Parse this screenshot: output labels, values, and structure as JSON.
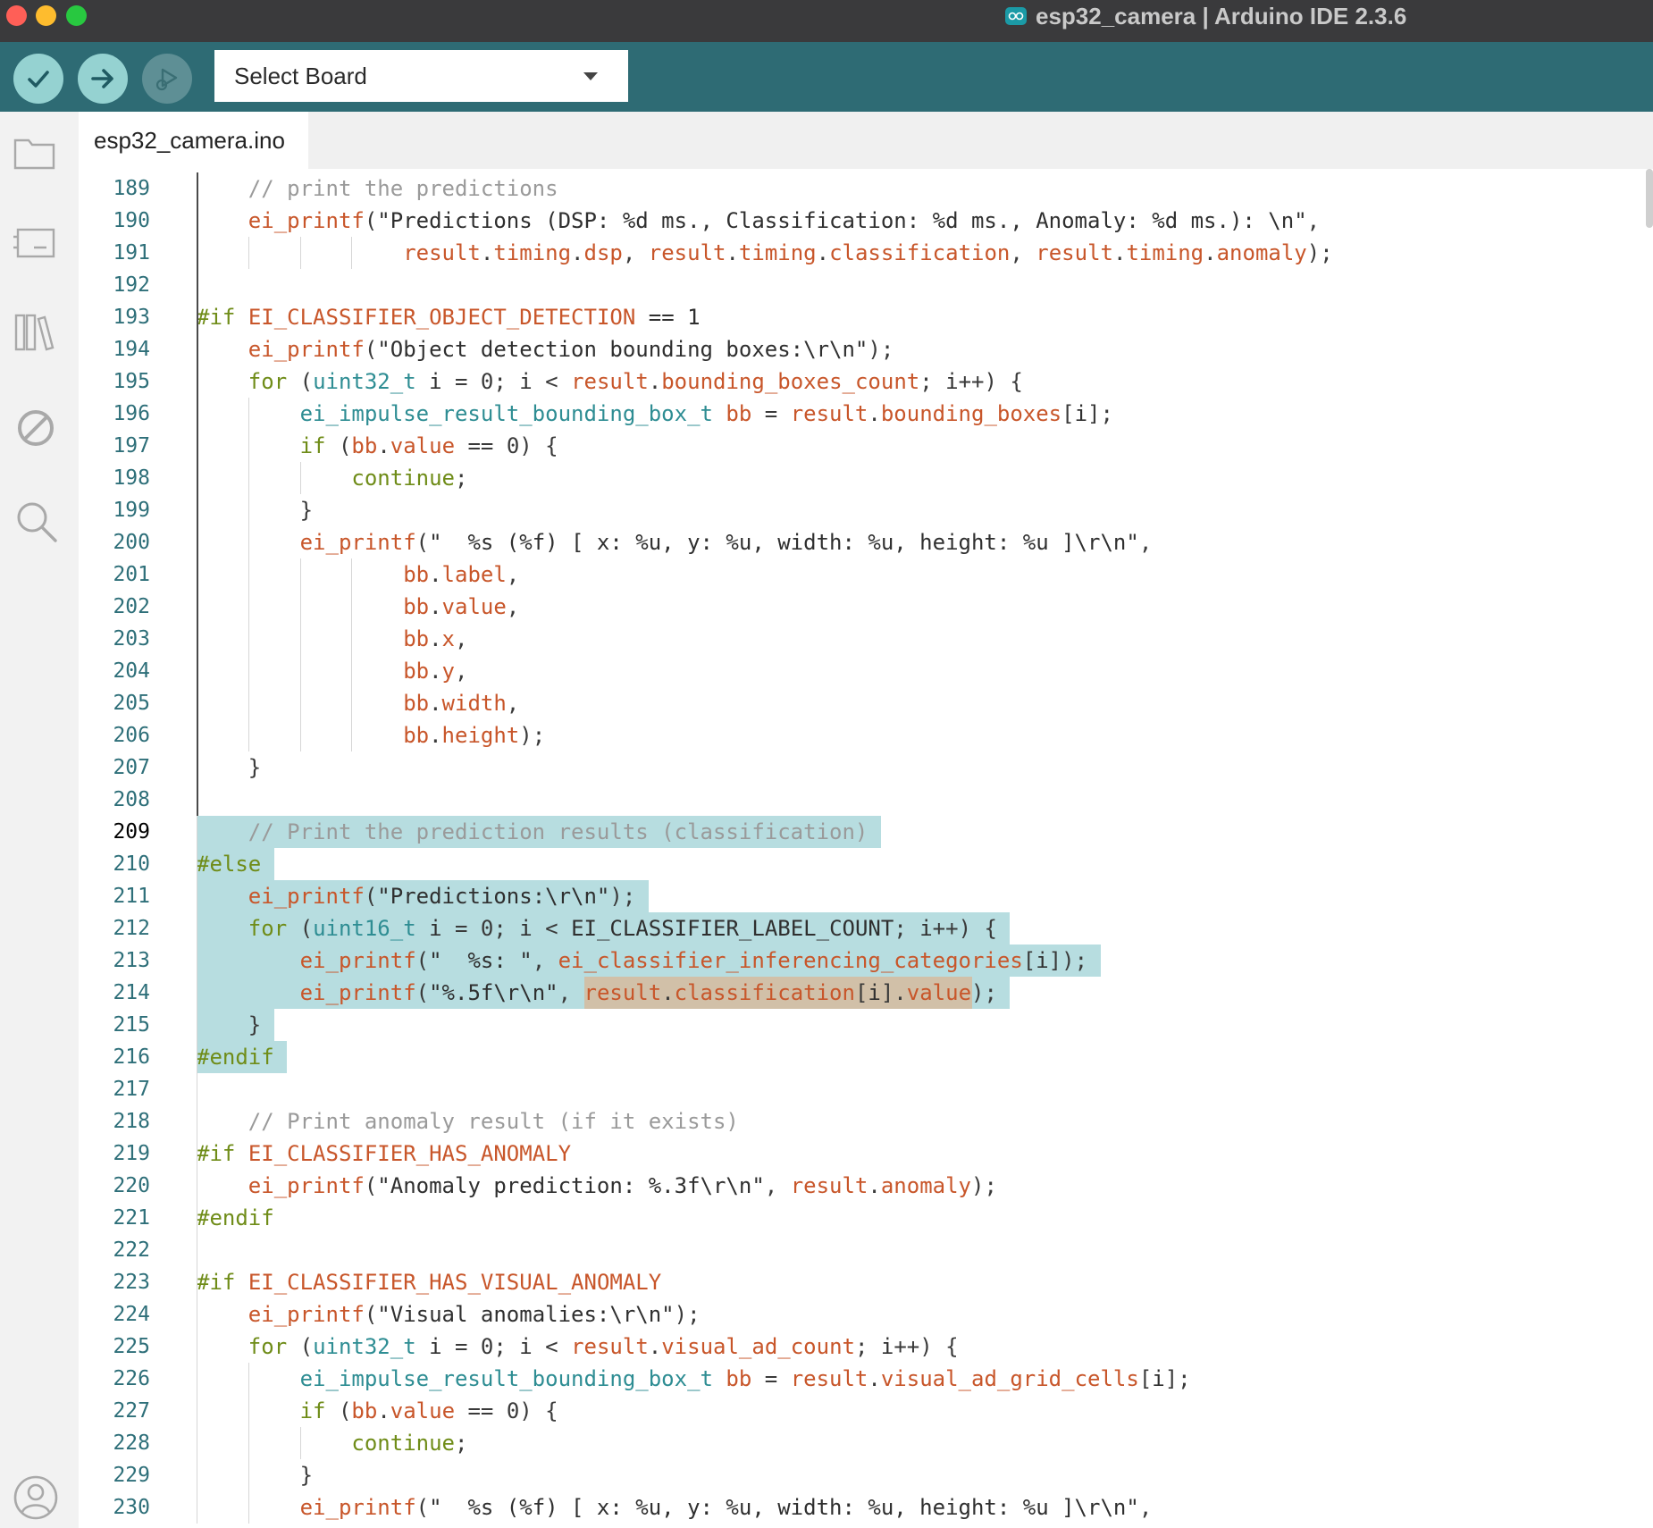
{
  "window": {
    "title": "esp32_camera | Arduino IDE 2.3.6",
    "traffic_colors": [
      "#ff5f57",
      "#febc2e",
      "#28c840"
    ]
  },
  "toolbar": {
    "verify_icon": "check-icon",
    "upload_icon": "arrow-right-icon",
    "debug_icon": "debug-icon",
    "board_select": "Select Board"
  },
  "sidebar": {
    "items": [
      "folder-icon",
      "board-icon",
      "library-icon",
      "debug-disabled-icon",
      "search-icon"
    ],
    "account": "account-icon"
  },
  "tab": {
    "label": "esp32_camera.ino"
  },
  "editor": {
    "current_line": "209",
    "lines": [
      {
        "n": "189",
        "text": "    // print the predictions"
      },
      {
        "n": "190",
        "text": "    ei_printf(\"Predictions (DSP: %d ms., Classification: %d ms., Anomaly: %d ms.): \\n\","
      },
      {
        "n": "191",
        "text": "                result.timing.dsp, result.timing.classification, result.timing.anomaly);"
      },
      {
        "n": "192",
        "text": ""
      },
      {
        "n": "193",
        "text": "#if EI_CLASSIFIER_OBJECT_DETECTION == 1"
      },
      {
        "n": "194",
        "text": "    ei_printf(\"Object detection bounding boxes:\\r\\n\");"
      },
      {
        "n": "195",
        "text": "    for (uint32_t i = 0; i < result.bounding_boxes_count; i++) {"
      },
      {
        "n": "196",
        "text": "        ei_impulse_result_bounding_box_t bb = result.bounding_boxes[i];"
      },
      {
        "n": "197",
        "text": "        if (bb.value == 0) {"
      },
      {
        "n": "198",
        "text": "            continue;"
      },
      {
        "n": "199",
        "text": "        }"
      },
      {
        "n": "200",
        "text": "        ei_printf(\"  %s (%f) [ x: %u, y: %u, width: %u, height: %u ]\\r\\n\","
      },
      {
        "n": "201",
        "text": "                bb.label,"
      },
      {
        "n": "202",
        "text": "                bb.value,"
      },
      {
        "n": "203",
        "text": "                bb.x,"
      },
      {
        "n": "204",
        "text": "                bb.y,"
      },
      {
        "n": "205",
        "text": "                bb.width,"
      },
      {
        "n": "206",
        "text": "                bb.height);"
      },
      {
        "n": "207",
        "text": "    }"
      },
      {
        "n": "208",
        "text": ""
      },
      {
        "n": "209",
        "text": "    // Print the prediction results (classification)"
      },
      {
        "n": "210",
        "text": "#else"
      },
      {
        "n": "211",
        "text": "    ei_printf(\"Predictions:\\r\\n\");"
      },
      {
        "n": "212",
        "text": "    for (uint16_t i = 0; i < EI_CLASSIFIER_LABEL_COUNT; i++) {"
      },
      {
        "n": "213",
        "text": "        ei_printf(\"  %s: \", ei_classifier_inferencing_categories[i]);"
      },
      {
        "n": "214",
        "text": "        ei_printf(\"%.5f\\r\\n\", result.classification[i].value);"
      },
      {
        "n": "215",
        "text": "    }"
      },
      {
        "n": "216",
        "text": "#endif"
      },
      {
        "n": "217",
        "text": ""
      },
      {
        "n": "218",
        "text": "    // Print anomaly result (if it exists)"
      },
      {
        "n": "219",
        "text": "#if EI_CLASSIFIER_HAS_ANOMALY"
      },
      {
        "n": "220",
        "text": "    ei_printf(\"Anomaly prediction: %.3f\\r\\n\", result.anomaly);"
      },
      {
        "n": "221",
        "text": "#endif"
      },
      {
        "n": "222",
        "text": ""
      },
      {
        "n": "223",
        "text": "#if EI_CLASSIFIER_HAS_VISUAL_ANOMALY"
      },
      {
        "n": "224",
        "text": "    ei_printf(\"Visual anomalies:\\r\\n\");"
      },
      {
        "n": "225",
        "text": "    for (uint32_t i = 0; i < result.visual_ad_count; i++) {"
      },
      {
        "n": "226",
        "text": "        ei_impulse_result_bounding_box_t bb = result.visual_ad_grid_cells[i];"
      },
      {
        "n": "227",
        "text": "        if (bb.value == 0) {"
      },
      {
        "n": "228",
        "text": "            continue;"
      },
      {
        "n": "229",
        "text": "        }"
      },
      {
        "n": "230",
        "text": "        ei_printf(\"  %s (%f) [ x: %u, y: %u, width: %u, height: %u ]\\r\\n\","
      }
    ]
  }
}
